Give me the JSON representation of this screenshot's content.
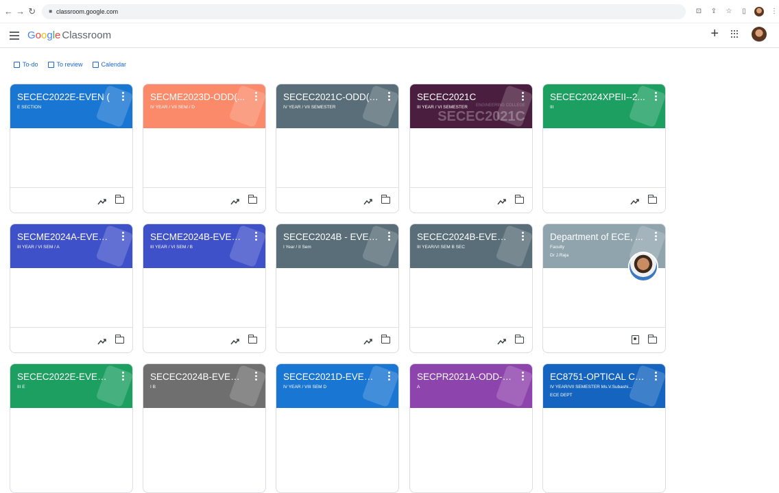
{
  "browser": {
    "url": "classroom.google.com"
  },
  "app": {
    "logo_google": "Google",
    "logo_product": "Classroom"
  },
  "subnav": {
    "todo": "To-do",
    "to_review": "To review",
    "calendar": "Calendar"
  },
  "cards": [
    {
      "title": "SECEC2022E-EVEN (",
      "sub": "E SECTION",
      "color": "#1976d2"
    },
    {
      "title": "SECME2023D-ODD(...",
      "sub": "IV YEAR / VII SEM / D",
      "color": "#fb8a6a"
    },
    {
      "title": "SECEC2021C-ODD(2...",
      "sub": "IV YEAR / VII SEMESTER",
      "color": "#596e79"
    },
    {
      "title": "SECEC2021C",
      "sub": "III YEAR / VI SEMESTER",
      "watermark": "SECEC2021C",
      "watermark_top": "ENGINEERING COLLEGE",
      "color": "#4a1e3f"
    },
    {
      "title": "SECEC2024XPEII--2...",
      "sub": "III",
      "color": "#1e9f62"
    },
    {
      "title": "SECME2024A-EVEN(...",
      "sub": "III YEAR / VI SEM / A",
      "color": "#3f51c8"
    },
    {
      "title": "SECME2024B-EVEN(...",
      "sub": "III YEAR / VI SEM / B",
      "color": "#3f51c8"
    },
    {
      "title": "SECEC2024B - EVEN(...",
      "sub": "I Year / II Sem",
      "color": "#596e79"
    },
    {
      "title": "SECEC2024B-EVEN(...",
      "sub": "III YEAR/VI SEM B SEC",
      "color": "#596e79"
    },
    {
      "title": "Department of ECE, ...",
      "sub": "Faculty",
      "sub2": "Dr J.Raja",
      "color": "#90a4ae"
    },
    {
      "title": "SECEC2022E-EVEN-...",
      "sub": "III E",
      "color": "#1e9f62"
    },
    {
      "title": "SECEC2024B-EVEN-...",
      "sub": "I B",
      "color": "#6f6f6f"
    },
    {
      "title": "SECEC2021D-EVEN(2...",
      "sub": "IV YEAR / VIII SEM D",
      "color": "#1976d2"
    },
    {
      "title": "SECPR2021A-ODD-P...",
      "sub": "A",
      "color": "#8e44ad"
    },
    {
      "title": "EC8751-OPTICAL CO...",
      "sub": "IV YEAR/VII SEMESTER Ms.V.Subashi...",
      "sub2": "ECE DEPT",
      "color": "#1565c0"
    }
  ]
}
